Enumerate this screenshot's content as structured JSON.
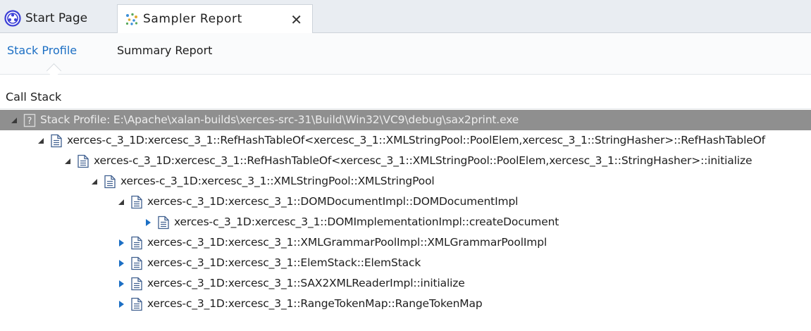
{
  "tabs": {
    "start_page": "Start Page",
    "sampler_report": "Sampler Report",
    "close_glyph": "✕"
  },
  "subtabs": {
    "stack_profile": "Stack Profile",
    "summary_report": "Summary Report"
  },
  "call_stack": {
    "header": "Call Stack",
    "rows": [
      {
        "label": "Stack Profile: E:\\Apache\\xalan-builds\\xerces-src-31\\Build\\Win32\\VC9\\debug\\sax2print.exe",
        "depth": 0,
        "expanded": true,
        "icon": "help-icon",
        "selected": true
      },
      {
        "label": "xerces-c_3_1D:xercesc_3_1::RefHashTableOf<xercesc_3_1::XMLStringPool::PoolElem,xercesc_3_1::StringHasher>::RefHashTableOf",
        "depth": 1,
        "expanded": true,
        "icon": "document-icon",
        "selected": false
      },
      {
        "label": "xerces-c_3_1D:xercesc_3_1::RefHashTableOf<xercesc_3_1::XMLStringPool::PoolElem,xercesc_3_1::StringHasher>::initialize",
        "depth": 2,
        "expanded": true,
        "icon": "document-icon",
        "selected": false
      },
      {
        "label": "xerces-c_3_1D:xercesc_3_1::XMLStringPool::XMLStringPool",
        "depth": 3,
        "expanded": true,
        "icon": "document-icon",
        "selected": false
      },
      {
        "label": "xerces-c_3_1D:xercesc_3_1::DOMDocumentImpl::DOMDocumentImpl",
        "depth": 4,
        "expanded": true,
        "icon": "document-icon",
        "selected": false
      },
      {
        "label": "xerces-c_3_1D:xercesc_3_1::DOMImplementationImpl::createDocument",
        "depth": 5,
        "expanded": false,
        "icon": "document-icon",
        "selected": false
      },
      {
        "label": "xerces-c_3_1D:xercesc_3_1::XMLGrammarPoolImpl::XMLGrammarPoolImpl",
        "depth": 4,
        "expanded": false,
        "icon": "document-icon",
        "selected": false
      },
      {
        "label": "xerces-c_3_1D:xercesc_3_1::ElemStack::ElemStack",
        "depth": 4,
        "expanded": false,
        "icon": "document-icon",
        "selected": false
      },
      {
        "label": "xerces-c_3_1D:xercesc_3_1::SAX2XMLReaderImpl::initialize",
        "depth": 4,
        "expanded": false,
        "icon": "document-icon",
        "selected": false
      },
      {
        "label": "xerces-c_3_1D:xercesc_3_1::RangeTokenMap::RangeTokenMap",
        "depth": 4,
        "expanded": false,
        "icon": "document-icon",
        "selected": false
      }
    ]
  },
  "colors": {
    "accent_link": "#1c6fc4",
    "selection": "#8f8f8f",
    "tree_arrow": "#1c6fc4"
  }
}
